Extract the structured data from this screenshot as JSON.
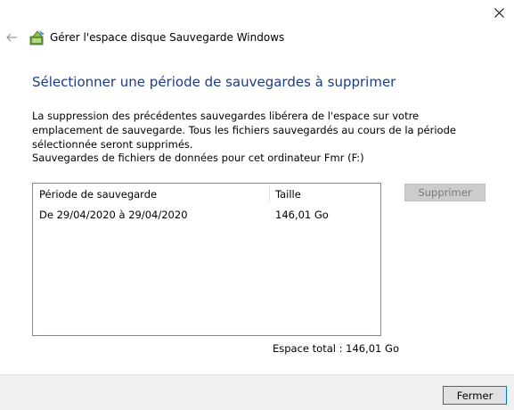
{
  "window": {
    "title": "Gérer l'espace disque Sauvegarde Windows",
    "close_glyph": "✕"
  },
  "page": {
    "title": "Sélectionner une période de sauvegardes à supprimer",
    "description": "La suppression des précédentes sauvegardes libérera de l'espace sur votre emplacement de sauvegarde. Tous les fichiers sauvegardés au cours de la période sélectionnée seront supprimés.",
    "section_label": "Sauvegardes de fichiers de données pour cet ordinateur Fmr (F:)"
  },
  "table": {
    "columns": [
      "Période de sauvegarde",
      "Taille"
    ],
    "rows": [
      {
        "period": "De 29/04/2020 à 29/04/2020",
        "size": "146,01 Go"
      }
    ]
  },
  "actions": {
    "delete_label": "Supprimer",
    "close_label": "Fermer"
  },
  "summary": {
    "total_space": "Espace total : 146,01 Go"
  },
  "colors": {
    "title_blue": "#1a3c8c",
    "accent": "#0078d7"
  }
}
